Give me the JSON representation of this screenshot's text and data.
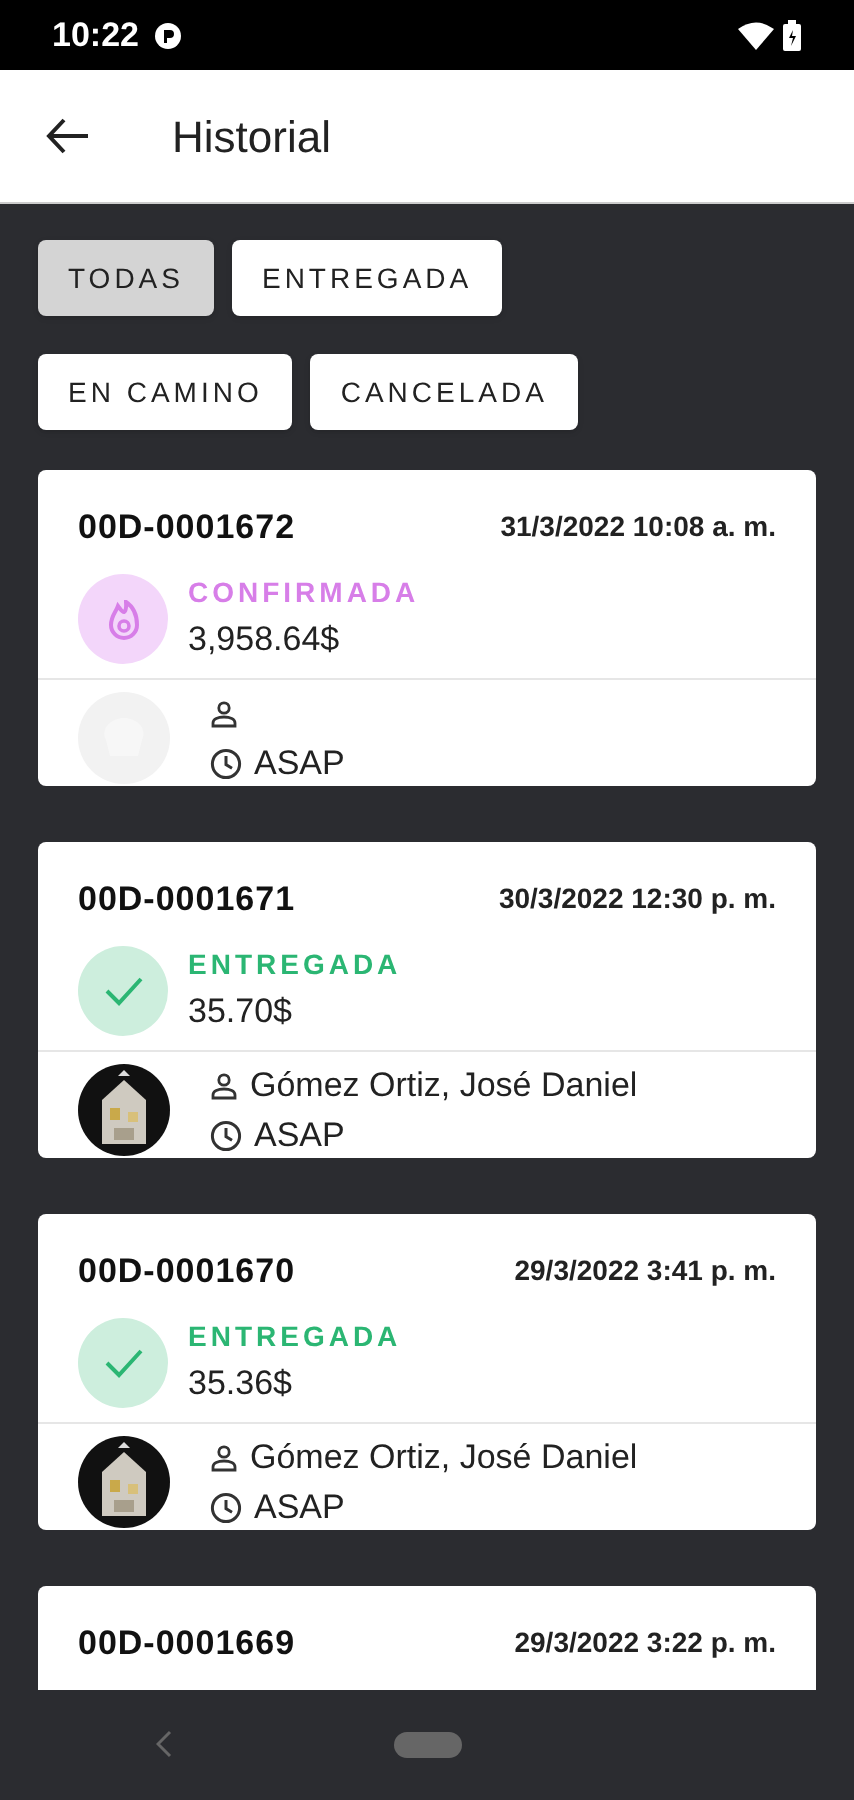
{
  "status_bar": {
    "time": "10:22"
  },
  "app_bar": {
    "title": "Historial"
  },
  "filters": [
    {
      "label": "TODAS",
      "selected": true
    },
    {
      "label": "ENTREGADA",
      "selected": false
    },
    {
      "label": "EN CAMINO",
      "selected": false
    },
    {
      "label": "CANCELADA",
      "selected": false
    }
  ],
  "orders": [
    {
      "id": "00D-0001672",
      "date": "31/3/2022 10:08 a. m.",
      "status": {
        "kind": "confirmada",
        "label": "CONFIRMADA"
      },
      "amount": "3,958.64$",
      "avatar": {
        "kind": "placeholder"
      },
      "schedule": "ASAP"
    },
    {
      "id": "00D-0001671",
      "date": "30/3/2022 12:30 p. m.",
      "status": {
        "kind": "entregada",
        "label": "ENTREGADA"
      },
      "amount": "35.70$",
      "customer": "Gómez Ortiz, José Daniel",
      "schedule": "ASAP"
    },
    {
      "id": "00D-0001670",
      "date": "29/3/2022 3:41 p. m.",
      "status": {
        "kind": "entregada",
        "label": "ENTREGADA"
      },
      "amount": "35.36$",
      "customer": "Gómez Ortiz, José Daniel",
      "schedule": "ASAP"
    },
    {
      "id": "00D-0001669",
      "date": "29/3/2022 3:22 p. m."
    }
  ]
}
